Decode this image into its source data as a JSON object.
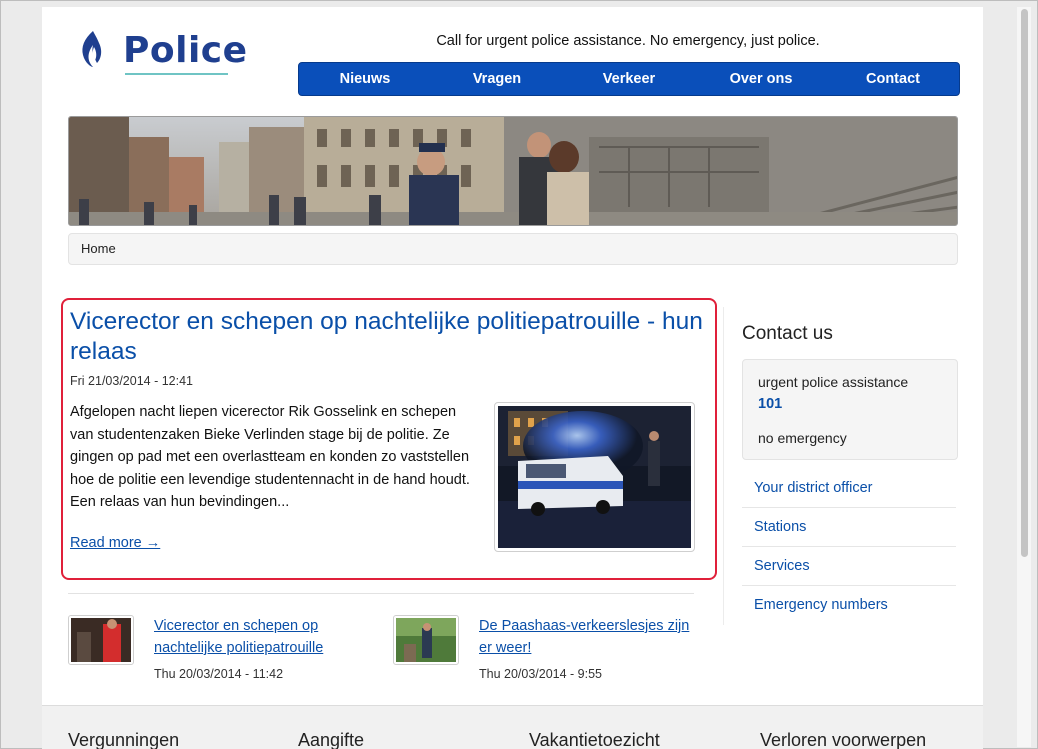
{
  "header": {
    "logo_text": "Police",
    "tagline": "Call for urgent police assistance. No emergency, just police.",
    "nav": [
      "Nieuws",
      "Vragen",
      "Verkeer",
      "Over ons",
      "Contact"
    ]
  },
  "breadcrumb": {
    "home": "Home"
  },
  "featured": {
    "title": "Vicerector en schepen op nachtelijke politiepatrouille - hun relaas",
    "date": "Fri 21/03/2014 - 12:41",
    "body": "Afgelopen nacht liepen vicerector Rik Gosselink en schepen van studentenzaken Bieke Verlinden stage bij de politie. Ze gingen op pad met een overlastteam en konden zo vaststellen hoe de politie een levendige studentennacht in de hand houdt. Een relaas van hun bevindingen...",
    "read_more": "Read more →"
  },
  "teasers": [
    {
      "title": "Vicerector en schepen op nachtelijke politiepatrouille",
      "date": "Thu 20/03/2014 - 11:42"
    },
    {
      "title": "De Paashaas-verkeerslesjes zijn er weer!",
      "date": "Thu 20/03/2014 - 9:55"
    }
  ],
  "sidebar": {
    "contact_title": "Contact us",
    "urgent_label": "urgent police assistance",
    "urgent_number": "101",
    "no_emergency_label": "no emergency",
    "links": [
      "Your district officer",
      "Stations",
      "Services",
      "Emergency numbers"
    ]
  },
  "footer": {
    "headings": [
      "Vergunningen",
      "Aangifte",
      "Vakantietoezicht",
      "Verloren voorwerpen"
    ]
  },
  "colors": {
    "brand_blue": "#0a4fba",
    "link_blue": "#0a4fa8",
    "highlight_red": "#e0203a"
  }
}
